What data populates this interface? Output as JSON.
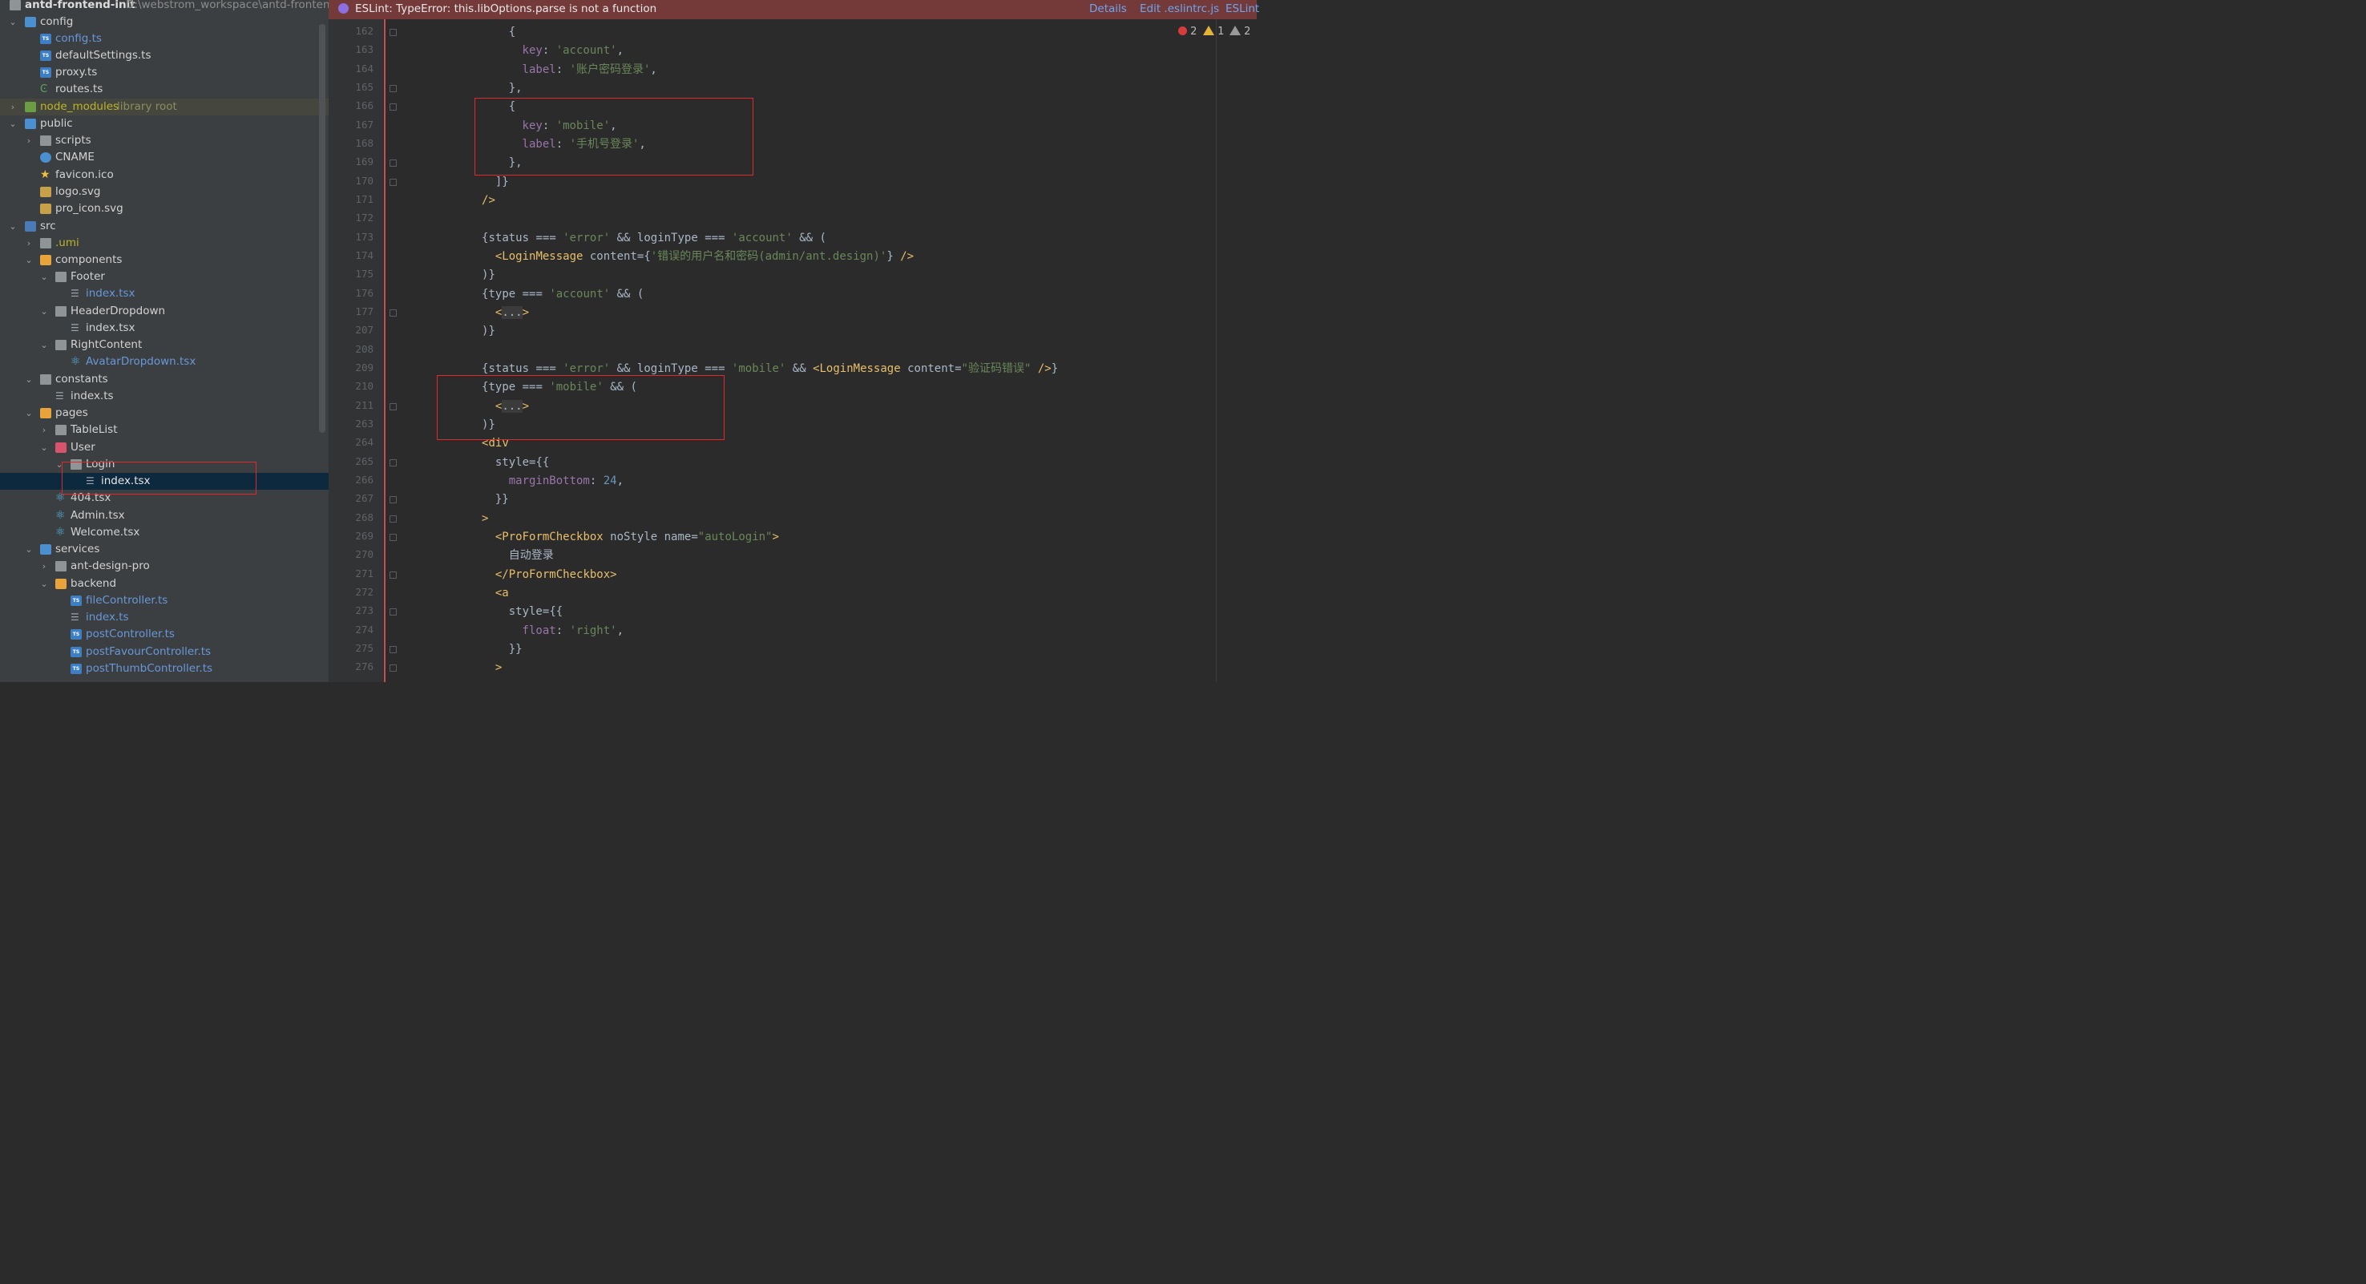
{
  "project": {
    "name": "antd-frontend-init",
    "path": "D:\\webstrom_workspace\\antd-frontend-i"
  },
  "tree": {
    "config": "config",
    "config_ts": "config.ts",
    "defaultSettings": "defaultSettings.ts",
    "proxy": "proxy.ts",
    "routes": "routes.ts",
    "node_modules": "node_modules",
    "library_root": "library root",
    "public": "public",
    "scripts": "scripts",
    "cname": "CNAME",
    "favicon": "favicon.ico",
    "logo": "logo.svg",
    "pro_icon": "pro_icon.svg",
    "src": "src",
    "umi": ".umi",
    "components": "components",
    "footer": "Footer",
    "footer_index": "index.tsx",
    "header_dropdown": "HeaderDropdown",
    "header_dropdown_index": "index.tsx",
    "right_content": "RightContent",
    "avatar_dropdown": "AvatarDropdown.tsx",
    "constants": "constants",
    "constants_index": "index.ts",
    "pages": "pages",
    "table_list": "TableList",
    "user": "User",
    "login": "Login",
    "login_index": "index.tsx",
    "page_404": "404.tsx",
    "admin": "Admin.tsx",
    "welcome": "Welcome.tsx",
    "services": "services",
    "ant_design_pro": "ant-design-pro",
    "backend": "backend",
    "file_controller": "fileController.ts",
    "backend_index": "index.ts",
    "post_controller": "postController.ts",
    "post_favour_controller": "postFavourController.ts",
    "post_thumb_controller": "postThumbController.ts"
  },
  "notice": {
    "message": "ESLint: TypeError: this.libOptions.parse is not a function",
    "details": "Details",
    "edit": "Edit .eslintrc.js",
    "eslint": "ESLint"
  },
  "inspections": {
    "errors": "2",
    "warnings": "1",
    "weak_warnings": "2"
  },
  "editor": {
    "lines": [
      {
        "n": "162",
        "i": 16,
        "tokens": [
          [
            "{",
            ""
          ]
        ]
      },
      {
        "n": "163",
        "i": 18,
        "tokens": [
          [
            "key",
            "k"
          ],
          [
            ": ",
            ""
          ],
          [
            "'account'",
            "s"
          ],
          [
            ",",
            ""
          ]
        ]
      },
      {
        "n": "164",
        "i": 18,
        "tokens": [
          [
            "label",
            "k"
          ],
          [
            ": ",
            ""
          ],
          [
            "'账户密码登录'",
            "s"
          ],
          [
            ",",
            ""
          ]
        ]
      },
      {
        "n": "165",
        "i": 16,
        "tokens": [
          [
            "},",
            ""
          ]
        ]
      },
      {
        "n": "166",
        "i": 16,
        "tokens": [
          [
            "{",
            ""
          ]
        ]
      },
      {
        "n": "167",
        "i": 18,
        "tokens": [
          [
            "key",
            "k"
          ],
          [
            ": ",
            ""
          ],
          [
            "'mobile'",
            "s"
          ],
          [
            ",",
            ""
          ]
        ]
      },
      {
        "n": "168",
        "i": 18,
        "tokens": [
          [
            "label",
            "k"
          ],
          [
            ": ",
            ""
          ],
          [
            "'手机号登录'",
            "s"
          ],
          [
            ",",
            ""
          ]
        ]
      },
      {
        "n": "169",
        "i": 16,
        "tokens": [
          [
            "},",
            ""
          ]
        ]
      },
      {
        "n": "170",
        "i": 14,
        "tokens": [
          [
            "]}",
            ""
          ]
        ]
      },
      {
        "n": "171",
        "i": 12,
        "tokens": [
          [
            "/>",
            "t"
          ]
        ]
      },
      {
        "n": "172",
        "i": 0,
        "tokens": []
      },
      {
        "n": "173",
        "i": 12,
        "tokens": [
          [
            "{status === ",
            ""
          ],
          [
            "'error'",
            "s"
          ],
          [
            " && loginType === ",
            ""
          ],
          [
            "'account'",
            "s"
          ],
          [
            " && (",
            ""
          ]
        ]
      },
      {
        "n": "174",
        "i": 14,
        "tokens": [
          [
            "<LoginMessage",
            "t"
          ],
          [
            " content",
            ""
          ],
          [
            "=",
            ""
          ],
          [
            "{",
            ""
          ],
          [
            "'错误的用户名和密码(admin/ant.design)'",
            "s"
          ],
          [
            "}",
            ""
          ],
          [
            " />",
            "t"
          ]
        ]
      },
      {
        "n": "175",
        "i": 12,
        "tokens": [
          [
            ")}",
            ""
          ]
        ]
      },
      {
        "n": "176",
        "i": 12,
        "tokens": [
          [
            "{type === ",
            ""
          ],
          [
            "'account'",
            "s"
          ],
          [
            " && (",
            ""
          ]
        ]
      },
      {
        "n": "177",
        "i": 14,
        "tokens": [
          [
            "<",
            "t"
          ],
          [
            "...",
            "sel"
          ],
          [
            ">",
            "t"
          ]
        ]
      },
      {
        "n": "207",
        "i": 12,
        "tokens": [
          [
            ")}",
            ""
          ]
        ]
      },
      {
        "n": "208",
        "i": 0,
        "tokens": []
      },
      {
        "n": "209",
        "i": 12,
        "tokens": [
          [
            "{status === ",
            ""
          ],
          [
            "'error'",
            "s"
          ],
          [
            " && loginType === ",
            ""
          ],
          [
            "'mobile'",
            "s"
          ],
          [
            " && ",
            ""
          ],
          [
            "<LoginMessage",
            "t"
          ],
          [
            " content",
            ""
          ],
          [
            "=",
            ""
          ],
          [
            "\"验证码错误\"",
            "s"
          ],
          [
            " />",
            "t"
          ],
          [
            "}",
            ""
          ]
        ]
      },
      {
        "n": "210",
        "i": 12,
        "tokens": [
          [
            "{type === ",
            ""
          ],
          [
            "'mobile'",
            "s"
          ],
          [
            " && (",
            ""
          ]
        ]
      },
      {
        "n": "211",
        "i": 14,
        "tokens": [
          [
            "<",
            "t"
          ],
          [
            "...",
            "sel"
          ],
          [
            ">",
            "t"
          ]
        ]
      },
      {
        "n": "263",
        "i": 12,
        "tokens": [
          [
            ")}",
            ""
          ]
        ]
      },
      {
        "n": "264",
        "i": 12,
        "tokens": [
          [
            "<div",
            "t"
          ]
        ]
      },
      {
        "n": "265",
        "i": 14,
        "tokens": [
          [
            "style",
            ""
          ],
          [
            "=",
            ""
          ],
          [
            "{{",
            ""
          ]
        ]
      },
      {
        "n": "266",
        "i": 16,
        "tokens": [
          [
            "marginBottom",
            "k"
          ],
          [
            ": ",
            ""
          ],
          [
            "24",
            "n"
          ],
          [
            ",",
            ""
          ]
        ]
      },
      {
        "n": "267",
        "i": 14,
        "tokens": [
          [
            "}}",
            ""
          ]
        ]
      },
      {
        "n": "268",
        "i": 12,
        "tokens": [
          [
            ">",
            "t"
          ]
        ]
      },
      {
        "n": "269",
        "i": 14,
        "tokens": [
          [
            "<ProFormCheckbox",
            "t"
          ],
          [
            " noStyle",
            ""
          ],
          [
            " name",
            ""
          ],
          [
            "=",
            ""
          ],
          [
            "\"autoLogin\"",
            "s"
          ],
          [
            ">",
            "t"
          ]
        ]
      },
      {
        "n": "270",
        "i": 16,
        "tokens": [
          [
            "自动登录",
            ""
          ]
        ]
      },
      {
        "n": "271",
        "i": 14,
        "tokens": [
          [
            "</ProFormCheckbox>",
            "t"
          ]
        ]
      },
      {
        "n": "272",
        "i": 14,
        "tokens": [
          [
            "<a",
            "t"
          ]
        ]
      },
      {
        "n": "273",
        "i": 16,
        "tokens": [
          [
            "style",
            ""
          ],
          [
            "=",
            ""
          ],
          [
            "{{",
            ""
          ]
        ]
      },
      {
        "n": "274",
        "i": 18,
        "tokens": [
          [
            "float",
            "k"
          ],
          [
            ": ",
            ""
          ],
          [
            "'right'",
            "s"
          ],
          [
            ",",
            ""
          ]
        ]
      },
      {
        "n": "275",
        "i": 16,
        "tokens": [
          [
            "}}",
            ""
          ]
        ]
      },
      {
        "n": "276",
        "i": 14,
        "tokens": [
          [
            ">",
            "t"
          ]
        ]
      }
    ]
  }
}
